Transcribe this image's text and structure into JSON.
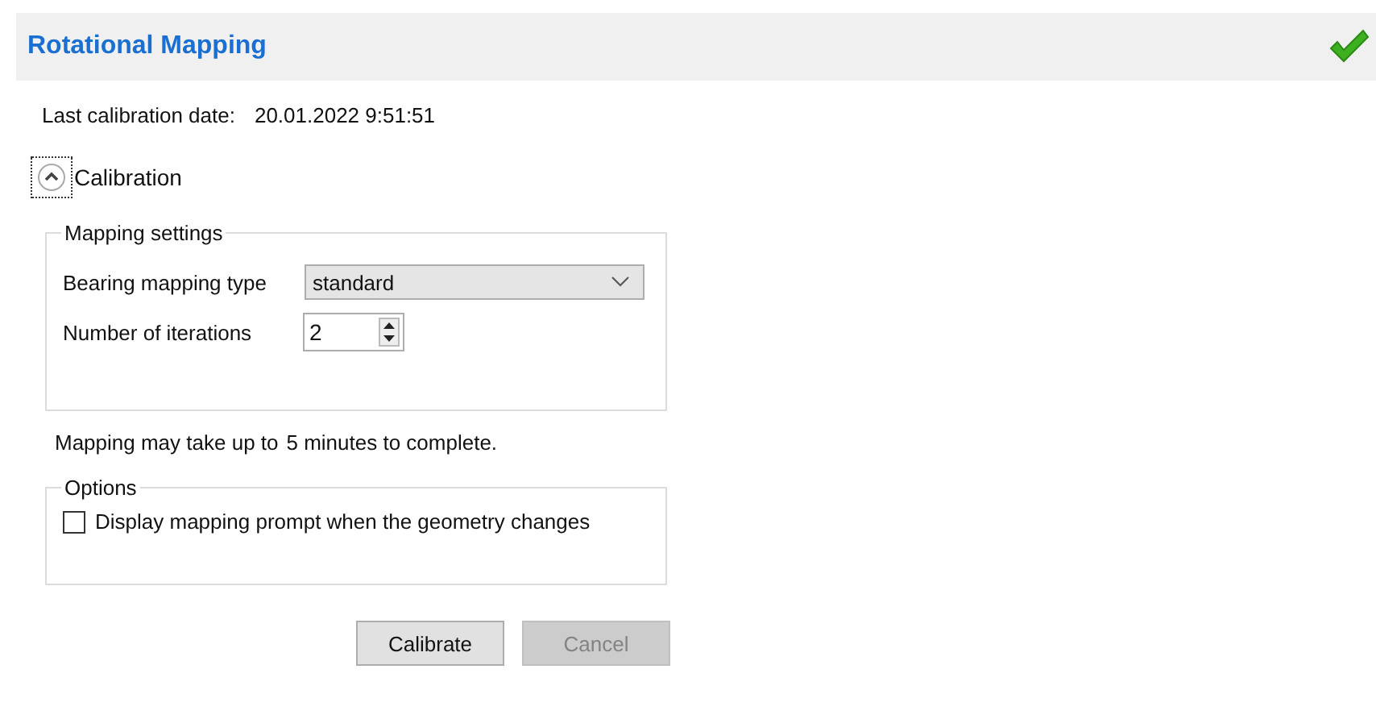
{
  "header": {
    "title": "Rotational Mapping"
  },
  "last_calibration": {
    "label": "Last calibration date:",
    "value": "20.01.2022 9:51:51"
  },
  "calibration": {
    "label": "Calibration",
    "expanded": true
  },
  "mapping_settings": {
    "title": "Mapping settings",
    "fields": [
      {
        "kind": "dropdown",
        "label": "Bearing mapping type",
        "value": "standard"
      },
      {
        "kind": "spinner",
        "label": "Number of iterations",
        "value": "2"
      }
    ]
  },
  "note": {
    "prefix": "Mapping may take up to",
    "value": "5 minutes to complete."
  },
  "options": {
    "title": "Options",
    "items": [
      {
        "label": "Display mapping prompt when the geometry changes",
        "checked": false
      }
    ]
  },
  "buttons": [
    {
      "label": "Calibrate",
      "disabled": false
    },
    {
      "label": "Cancel",
      "disabled": true
    }
  ]
}
